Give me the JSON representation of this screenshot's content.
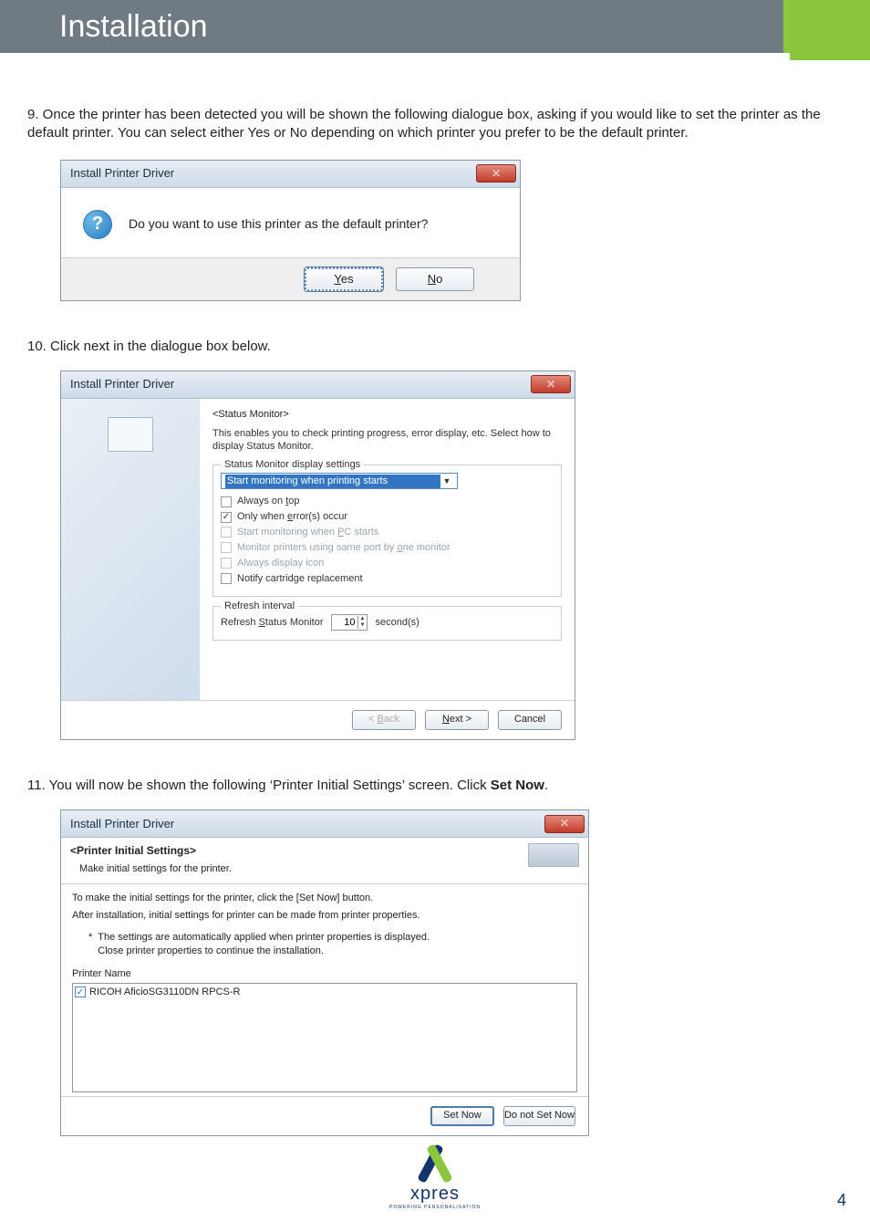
{
  "page": {
    "title": "Installation",
    "number": "4"
  },
  "step9": {
    "text": "9. Once the printer has been detected you will be shown the following dialogue box, asking if you would like to set the printer as the default printer. You can select either Yes or No depending on which printer you prefer to be the default printer."
  },
  "dlg1": {
    "title": "Install Printer Driver",
    "message": "Do you want to use this printer as the default printer?",
    "yes_pre": "Y",
    "yes_post": "es",
    "no_pre": "N",
    "no_post": "o"
  },
  "step10": {
    "text": "10. Click next in the dialogue box below."
  },
  "dlg2": {
    "title": "Install Printer Driver",
    "header": "<Status Monitor>",
    "desc": "This enables you to check printing progress, error display, etc. Select how to display Status Monitor.",
    "group1_title": "Status Monitor display settings",
    "combo_value": "Start monitoring when printing starts",
    "opt_always_top_pre": "Always on ",
    "opt_always_top_u": "t",
    "opt_always_top_post": "op",
    "opt_only_errors_pre": "Only when ",
    "opt_only_errors_u": "e",
    "opt_only_errors_post": "rror(s) occur",
    "opt_start_pc_pre": "Start monitoring when ",
    "opt_start_pc_u": "P",
    "opt_start_pc_post": "C starts",
    "opt_same_port_pre": "Monitor printers using same port by ",
    "opt_same_port_u": "o",
    "opt_same_port_post": "ne monitor",
    "opt_always_icon": "Always display icon",
    "opt_notify": "Notify cartridge replacement",
    "group2_title": "Refresh interval",
    "refresh_label_pre": "Refresh ",
    "refresh_label_u": "S",
    "refresh_label_post": "tatus Monitor",
    "refresh_value": "10",
    "refresh_unit": "second(s)",
    "back_pre": "< ",
    "back_u": "B",
    "back_post": "ack",
    "next_u": "N",
    "next_post": "ext >",
    "cancel": "Cancel"
  },
  "step11": {
    "pre": "11. You will now be shown the following ‘Printer Initial Settings’ screen. Click ",
    "bold": "Set Now",
    "post": "."
  },
  "dlg3": {
    "title": "Install Printer Driver",
    "header_bold": "<Printer Initial Settings>",
    "header_sub": "Make initial settings for the printer.",
    "line1": "To make the initial settings for the printer, click the [Set Now] button.",
    "line2": "After installation, initial settings for printer can be made from printer properties.",
    "note1": "The settings are automatically applied when printer properties is displayed.",
    "note2": "Close printer properties to continue the installation.",
    "pname_label": "Printer Name",
    "pname_value": "RICOH AficioSG3110DN RPCS-R",
    "setnow": "Set Now",
    "donot": "Do not Set Now"
  },
  "logo": {
    "text": "xpres",
    "sub": "POWERING PERSONALISATION"
  }
}
